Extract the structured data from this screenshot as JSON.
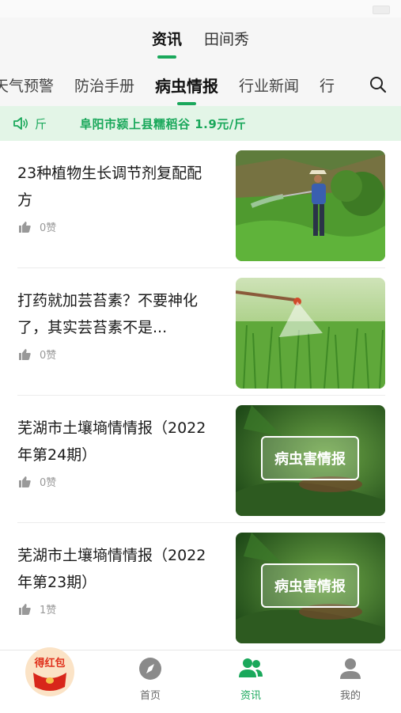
{
  "header": {
    "tabs": [
      {
        "label": "资讯",
        "active": true
      },
      {
        "label": "田间秀",
        "active": false
      }
    ]
  },
  "categories": {
    "items": [
      {
        "label": "天气预警",
        "active": false
      },
      {
        "label": "防治手册",
        "active": false
      },
      {
        "label": "病虫情报",
        "active": true
      },
      {
        "label": "行业新闻",
        "active": false
      },
      {
        "label": "行",
        "active": false
      }
    ],
    "search_icon": "search-icon"
  },
  "ticker": {
    "icon": "speaker-icon",
    "unit_fragment": "斤",
    "text": "阜阳市颍上县糯稻谷 1.9元/斤"
  },
  "articles": [
    {
      "title": "23种植物生长调节剂复配配方",
      "likes": "0赞",
      "thumb": "farmer-spraying-photo"
    },
    {
      "title": "打药就加芸苔素？不要神化了，其实芸苔素不是...",
      "likes": "0赞",
      "thumb": "sprayer-wheat-photo"
    },
    {
      "title": "芜湖市土壤墒情情报（2022年第24期）",
      "likes": "0赞",
      "thumb": "pest-report-banner",
      "thumb_text": "病虫害情报"
    },
    {
      "title": "芜湖市土壤墒情情报（2022年第23期）",
      "likes": "1赞",
      "thumb": "pest-report-banner",
      "thumb_text": "病虫害情报"
    }
  ],
  "bottom_nav": {
    "red_packet_label": "得红包",
    "items": [
      {
        "label": "首页",
        "icon": "compass-icon",
        "active": false
      },
      {
        "label": "资讯",
        "icon": "users-icon",
        "active": true
      },
      {
        "label": "我的",
        "icon": "person-icon",
        "active": false
      }
    ]
  },
  "colors": {
    "accent": "#1aa85b",
    "ticker_bg": "#e3f5e7",
    "red_packet": "#e0311c"
  }
}
